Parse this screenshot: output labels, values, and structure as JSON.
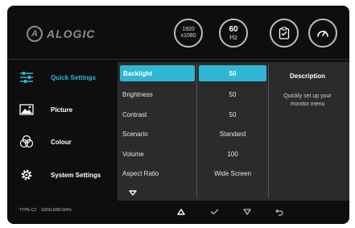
{
  "brand": {
    "logo_text": "ALOGIC",
    "logo_letter": "A"
  },
  "status": {
    "resolution_line1": "1920",
    "resolution_line2": "x1080",
    "refresh_value": "60",
    "refresh_unit": "Hz",
    "extra_icons": [
      "clipboard-icon",
      "gauge-icon"
    ]
  },
  "sidebar": {
    "items": [
      {
        "label": "Quick Settings",
        "icon": "sliders-icon",
        "active": true
      },
      {
        "label": "Picture",
        "icon": "picture-icon",
        "active": false
      },
      {
        "label": "Colour",
        "icon": "colour-icon",
        "active": false
      },
      {
        "label": "System Settings",
        "icon": "gear-icon",
        "active": false
      }
    ]
  },
  "menu": {
    "labels": [
      "Backlight",
      "Brightness",
      "Contrast",
      "Scenario",
      "Volume",
      "Aspect Ratio"
    ],
    "values": [
      "50",
      "50",
      "50",
      "Standard",
      "100",
      "Wide Screen"
    ],
    "selected_index": 0
  },
  "description": {
    "title": "Description",
    "text": "Quickly set up your monitor menu"
  },
  "footer": {
    "input": "TYPE-C2",
    "mode": "1920x1080 60Hz"
  },
  "nav_icons": [
    "up-arrow-icon",
    "check-icon",
    "down-arrow-icon",
    "back-icon"
  ],
  "colors": {
    "accent": "#2eb7d4",
    "background": "#0e0e0e",
    "panel": "#2b2b2b"
  }
}
